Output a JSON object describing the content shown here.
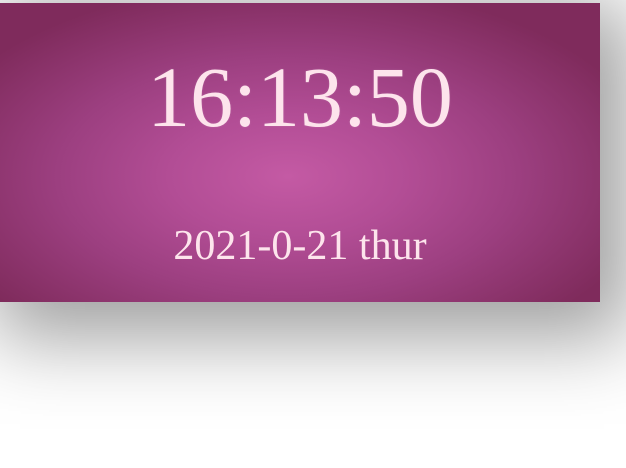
{
  "clock": {
    "time": "16:13:50",
    "date": "2021-0-21 thur"
  },
  "colors": {
    "card_center": "#c45aa4",
    "card_edge": "#7f2b5c",
    "text": "#fde4ec"
  }
}
